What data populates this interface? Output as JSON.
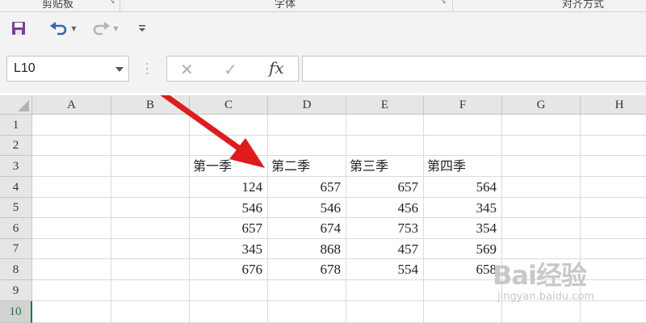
{
  "ribbon": {
    "groups": [
      {
        "label": "剪贴板"
      },
      {
        "label": "字体"
      },
      {
        "label": "对齐方式"
      }
    ]
  },
  "qat": {
    "save_icon": "save-icon",
    "undo_icon": "undo-icon",
    "redo_icon": "redo-icon",
    "customize_icon": "customize-qat-icon"
  },
  "formula_bar": {
    "name_box": "L10",
    "formula": "",
    "cancel_icon": "✕",
    "enter_icon": "✓",
    "fx_label": "fx"
  },
  "grid": {
    "columns": [
      "A",
      "B",
      "C",
      "D",
      "E",
      "F",
      "G",
      "H"
    ],
    "rows": [
      "1",
      "2",
      "3",
      "4",
      "5",
      "6",
      "7",
      "8",
      "9",
      "10"
    ],
    "selected_row": "10",
    "headers": [
      "第一季",
      "第二季",
      "第三季",
      "第四季"
    ],
    "data": [
      [
        "124",
        "657",
        "657",
        "564"
      ],
      [
        "546",
        "546",
        "456",
        "345"
      ],
      [
        "657",
        "674",
        "753",
        "354"
      ],
      [
        "345",
        "868",
        "457",
        "569"
      ],
      [
        "676",
        "678",
        "554",
        "658"
      ]
    ]
  },
  "colors": {
    "accent": "#217346",
    "arrow": "#e01b1b",
    "save": "#7a3e9d",
    "undo": "#2b6cb0"
  },
  "watermark": {
    "logo": "Bai经验",
    "sub": "jingyan.baidu.com"
  }
}
